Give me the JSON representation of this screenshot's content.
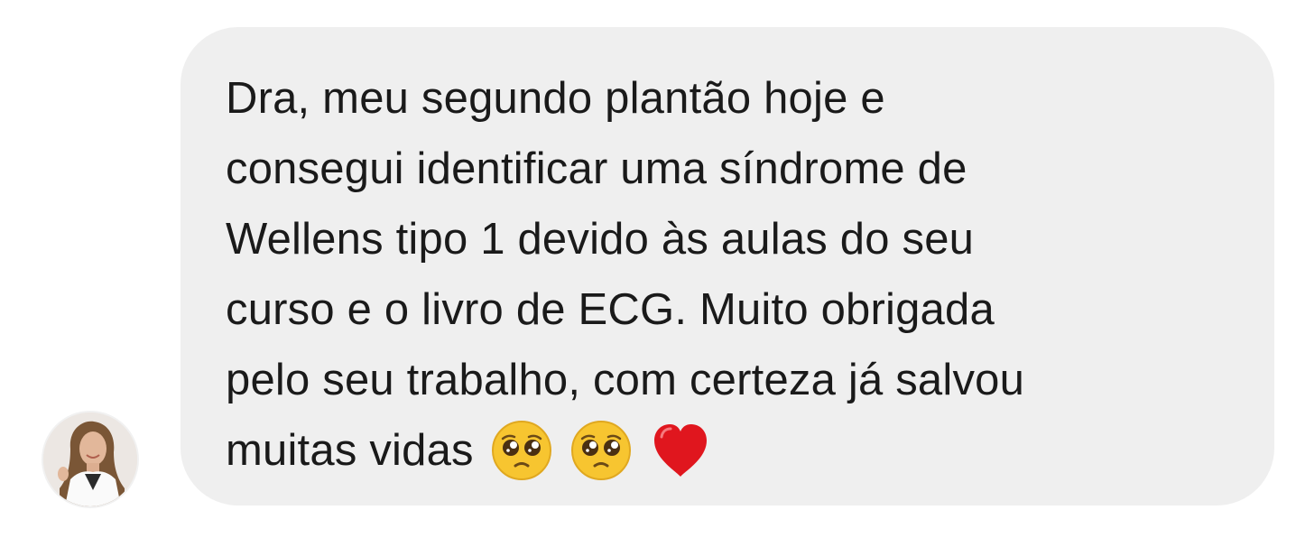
{
  "message": {
    "lines": [
      "Dra, meu segundo plantão hoje e",
      "consegui identificar uma síndrome de",
      "Wellens tipo 1 devido às aulas do seu",
      "curso e o livro de ECG. Muito obrigada",
      "pelo seu trabalho, com certeza já salvou",
      "muitas vidas"
    ],
    "emojis": [
      "pleading-face",
      "pleading-face",
      "red-heart"
    ]
  },
  "sender": {
    "avatar_icon": "profile-photo"
  },
  "colors": {
    "bubble": "#efefef",
    "text": "#1a1a1a",
    "heart": "#e0161e",
    "emoji_face": "#f7c530"
  }
}
